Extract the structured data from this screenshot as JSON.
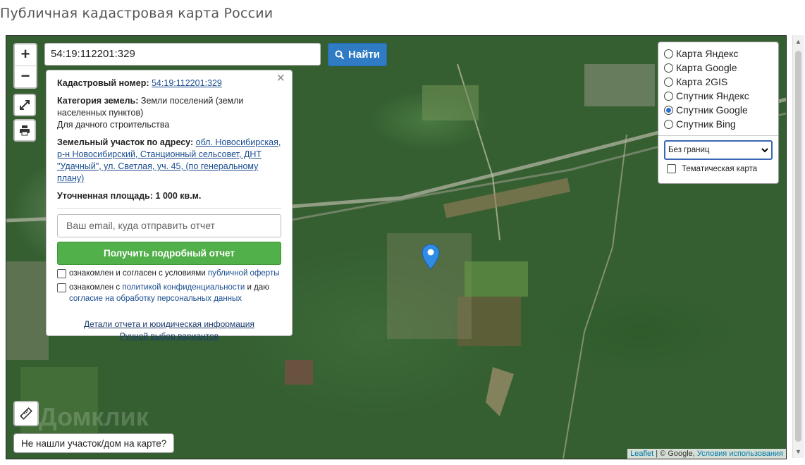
{
  "page": {
    "title": "Публичная кадастровая карта России"
  },
  "search": {
    "value": "54:19:112201:329",
    "button_label": "Найти"
  },
  "zoom": {
    "in": "+",
    "out": "−"
  },
  "info": {
    "close": "×",
    "cadastral_label": "Кадастровый номер:",
    "cadastral_value": "54:19:112201:329",
    "category_label": "Категория земель:",
    "category_value": "Земли поселений (земли населенных пунктов)",
    "use_value": "Для дачного строительства",
    "address_label": "Земельный участок по адресу:",
    "address_value": "обл. Новосибирская, р-н Новосибирский, Станционный сельсовет, ДНТ \"Удачный\", ул. Светлая, уч. 45, (по генеральному плану)",
    "area_label": "Уточненная площадь:",
    "area_value": "1 000 кв.м.",
    "email_placeholder": "Ваш email, куда отправить отчет",
    "report_button": "Получить подробный отчет",
    "agree1_text": "ознакомлен и согласен с условиями",
    "agree1_link": "публичной оферты",
    "agree2_text": "ознакомлен с",
    "agree2_link": "политикой конфиденциальности",
    "agree2_mid": "и даю",
    "agree2_link2": "согласие на обработку персональных данных",
    "link_details": "Детали отчета и юридическая информация",
    "link_manual": "Ручной выбор вариантов"
  },
  "layers": {
    "options": [
      {
        "label": "Карта Яндекс",
        "selected": false
      },
      {
        "label": "Карта Google",
        "selected": false
      },
      {
        "label": "Карта 2GIS",
        "selected": false
      },
      {
        "label": "Спутник Яндекс",
        "selected": false
      },
      {
        "label": "Спутник Google",
        "selected": true
      },
      {
        "label": "Спутник Bing",
        "selected": false
      }
    ],
    "borders_select": "Без границ",
    "thematic_label": "Тематическая карта"
  },
  "bottom": {
    "not_found": "Не нашли участок/дом на карте?"
  },
  "attribution": {
    "leaflet": "Leaflet",
    "sep": " | © Google, ",
    "terms": "Условия использования"
  },
  "watermark": "Домклик",
  "colors": {
    "accent": "#2f7cc4",
    "report": "#52b04a",
    "marker": "#2f8be6"
  }
}
